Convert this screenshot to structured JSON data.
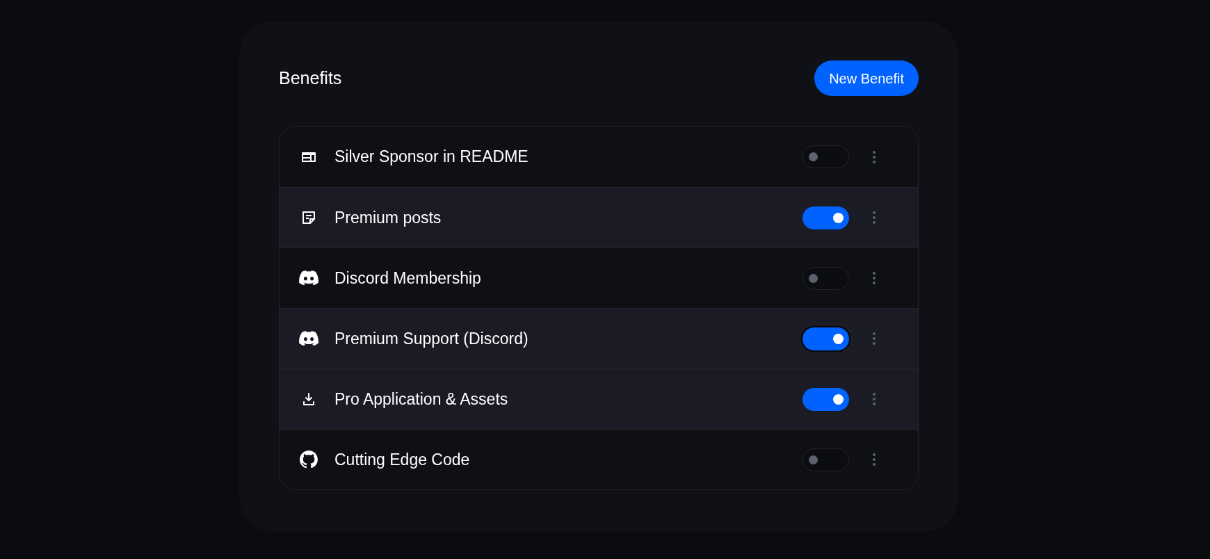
{
  "title": "Benefits",
  "new_button": "New Benefit",
  "benefits": [
    {
      "kind": "layout",
      "label": "Silver Sponsor in README",
      "on": false,
      "focused": false,
      "highlighted": false
    },
    {
      "kind": "note",
      "label": "Premium posts",
      "on": true,
      "focused": false,
      "highlighted": true
    },
    {
      "kind": "discord",
      "label": "Discord Membership",
      "on": false,
      "focused": false,
      "highlighted": false
    },
    {
      "kind": "discord",
      "label": "Premium Support (Discord)",
      "on": true,
      "focused": true,
      "highlighted": true
    },
    {
      "kind": "download",
      "label": "Pro Application & Assets",
      "on": true,
      "focused": false,
      "highlighted": true
    },
    {
      "kind": "github",
      "label": "Cutting Edge Code",
      "on": false,
      "focused": false,
      "highlighted": false
    }
  ]
}
